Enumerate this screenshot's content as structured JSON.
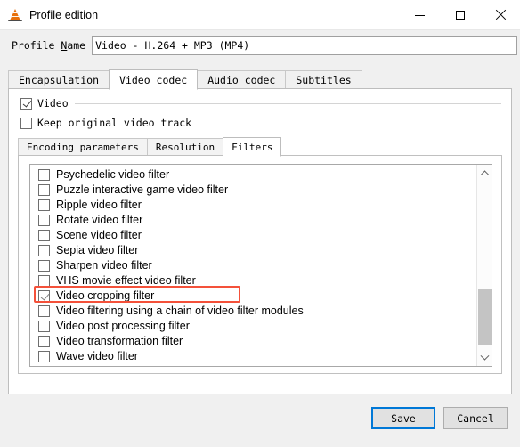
{
  "window": {
    "title": "Profile edition",
    "icon": "vlc-cone-icon",
    "controls": {
      "minimize": "minimize-icon",
      "maximize": "maximize-icon",
      "close": "close-icon"
    }
  },
  "profile": {
    "label_prefix": "Profile ",
    "label_mnemonic": "N",
    "label_suffix": "ame",
    "value": "Video - H.264 + MP3 (MP4)",
    "placeholder": ""
  },
  "outer_tabs": [
    {
      "label": "Encapsulation",
      "active": false
    },
    {
      "label": "Video codec",
      "active": true
    },
    {
      "label": "Audio codec",
      "active": false
    },
    {
      "label": "Subtitles",
      "active": false
    }
  ],
  "video_group": {
    "enabled_label": "Video",
    "enabled_checked": true,
    "keep_original_label": "Keep original video track",
    "keep_original_checked": false
  },
  "inner_tabs": [
    {
      "label": "Encoding parameters",
      "active": false
    },
    {
      "label": "Resolution",
      "active": false
    },
    {
      "label": "Filters",
      "active": true
    }
  ],
  "filters": [
    {
      "label": "Psychedelic video filter",
      "checked": false,
      "highlighted": false
    },
    {
      "label": "Puzzle interactive game video filter",
      "checked": false,
      "highlighted": false
    },
    {
      "label": "Ripple video filter",
      "checked": false,
      "highlighted": false
    },
    {
      "label": "Rotate video filter",
      "checked": false,
      "highlighted": false
    },
    {
      "label": "Scene video filter",
      "checked": false,
      "highlighted": false
    },
    {
      "label": "Sepia video filter",
      "checked": false,
      "highlighted": false
    },
    {
      "label": "Sharpen video filter",
      "checked": false,
      "highlighted": false
    },
    {
      "label": "VHS movie effect video filter",
      "checked": false,
      "highlighted": false
    },
    {
      "label": "Video cropping filter",
      "checked": true,
      "highlighted": true
    },
    {
      "label": "Video filtering using a chain of video filter modules",
      "checked": false,
      "highlighted": false
    },
    {
      "label": "Video post processing filter",
      "checked": false,
      "highlighted": false
    },
    {
      "label": "Video transformation filter",
      "checked": false,
      "highlighted": false
    },
    {
      "label": "Wave video filter",
      "checked": false,
      "highlighted": false
    }
  ],
  "scrollbar": {
    "up_arrow": "chevron-up-icon",
    "down_arrow": "chevron-down-icon"
  },
  "footer": {
    "save_label": "Save",
    "cancel_label": "Cancel"
  },
  "colors": {
    "accent": "#0078d7",
    "annotation": "#f4513a",
    "window_bg": "#f0f0f0",
    "panel_bg": "#ffffff"
  }
}
